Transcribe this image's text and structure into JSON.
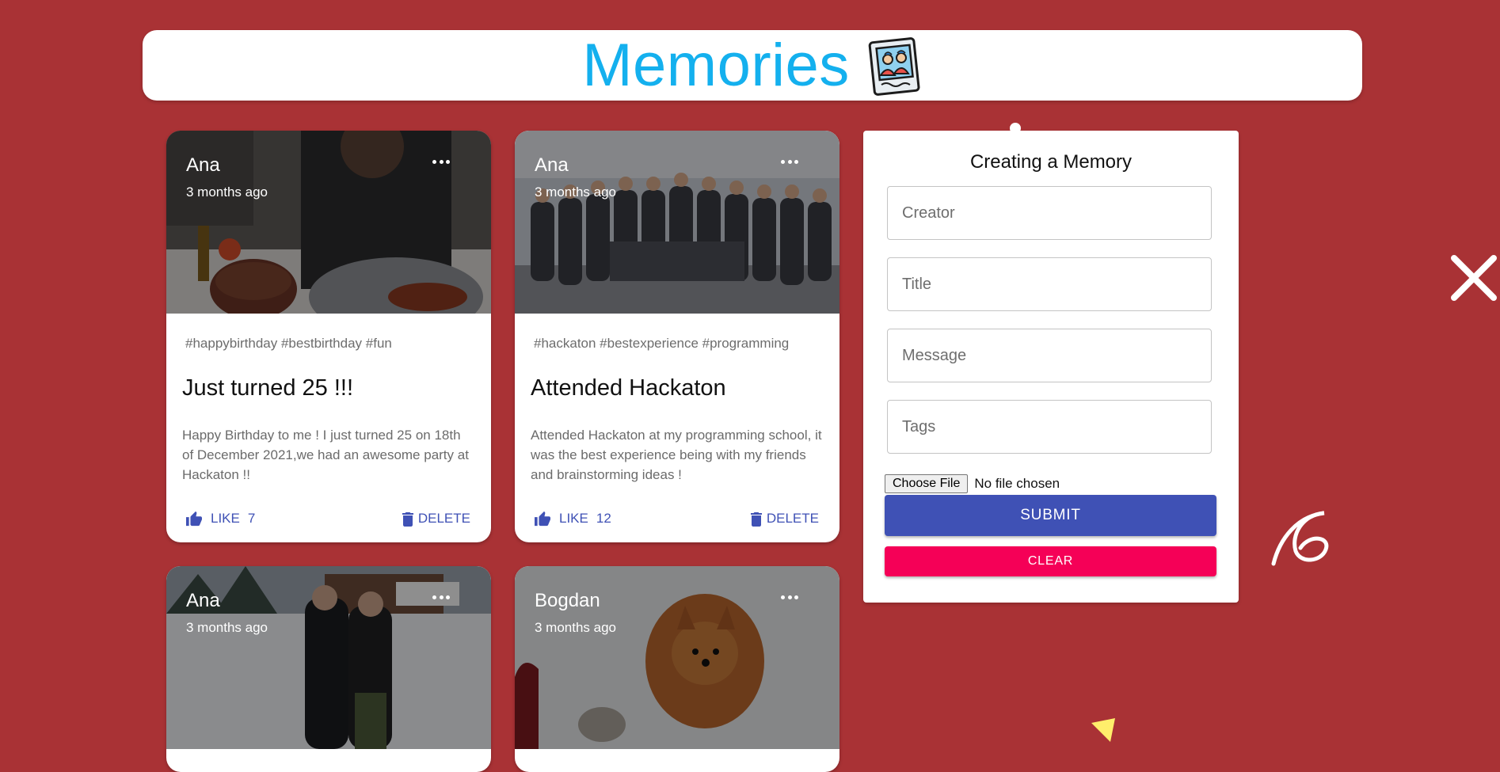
{
  "app": {
    "title": "Memories",
    "logo_icon": "memories-photo-icon",
    "accent_color": "#14b0ee",
    "background_color": "#a93235"
  },
  "posts": [
    {
      "creator": "Ana",
      "time": "3 months ago",
      "tags": "#happybirthday #bestbirthday #fun",
      "title": "Just turned 25 !!!",
      "message": "Happy Birthday to me ! I just turned 25 on 18th of December 2021,we had an awesome party at Hackaton !!",
      "like_label": "LIKE",
      "like_count": "7",
      "delete_label": "DELETE",
      "image": "birthday-cake-photo"
    },
    {
      "creator": "Ana",
      "time": "3 months ago",
      "tags": "#hackaton #bestexperience #programming",
      "title": "Attended Hackaton",
      "message": "Attended Hackaton at my programming school, it was the best experience being with my friends and brainstorming ideas !",
      "like_label": "LIKE",
      "like_count": "12",
      "delete_label": "DELETE",
      "image": "group-photo"
    },
    {
      "creator": "Ana",
      "time": "3 months ago",
      "image": "snow-couple-photo"
    },
    {
      "creator": "Bogdan",
      "time": "3 months ago",
      "image": "pomeranian-dog-photo"
    }
  ],
  "form": {
    "heading": "Creating a Memory",
    "creator_placeholder": "Creator",
    "title_placeholder": "Title",
    "message_placeholder": "Message",
    "tags_placeholder": "Tags",
    "file_button": "Choose File",
    "file_status": "No file chosen",
    "submit_label": "SUBMIT",
    "clear_label": "CLEAR",
    "submit_color": "#3f51b5",
    "clear_color": "#f50057"
  }
}
